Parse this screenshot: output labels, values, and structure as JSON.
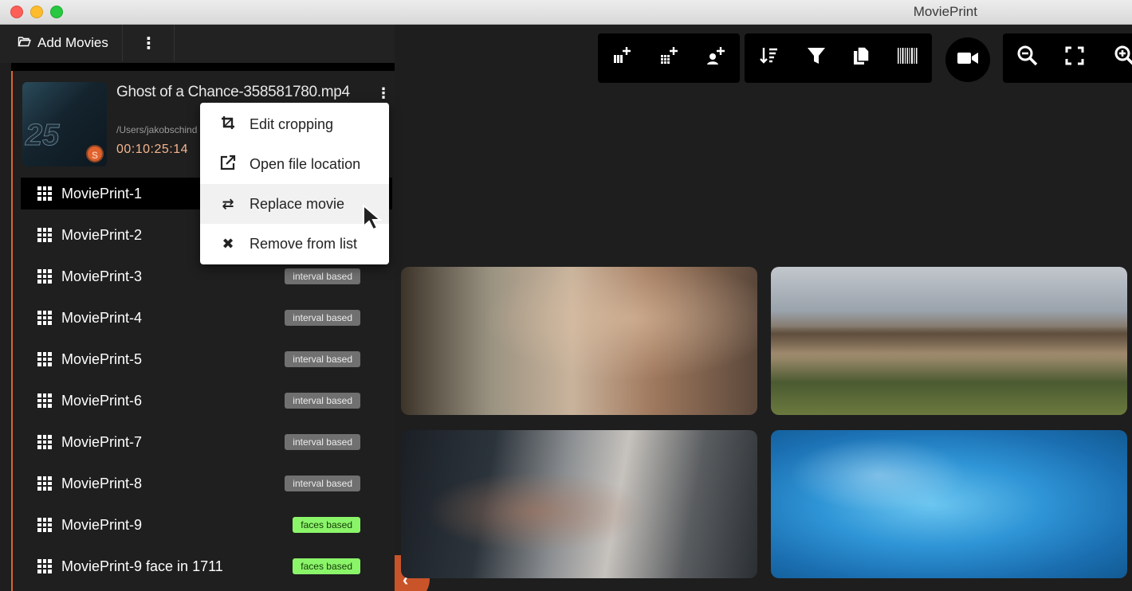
{
  "window": {
    "title": "MoviePrint"
  },
  "sidebar": {
    "add_movies_label": "Add Movies",
    "more_label": "⋮",
    "movie": {
      "name": "Ghost of a Chance-358581780.mp4",
      "path": "/Users/jakobschind",
      "duration": "00:10:25:14",
      "thumb_number": "25",
      "thumb_badge": "S"
    },
    "items": [
      {
        "label": "MoviePrint-1",
        "tag": ""
      },
      {
        "label": "MoviePrint-2",
        "tag": ""
      },
      {
        "label": "MoviePrint-3",
        "tag": "interval based"
      },
      {
        "label": "MoviePrint-4",
        "tag": "interval based"
      },
      {
        "label": "MoviePrint-5",
        "tag": "interval based"
      },
      {
        "label": "MoviePrint-6",
        "tag": "interval based"
      },
      {
        "label": "MoviePrint-7",
        "tag": "interval based"
      },
      {
        "label": "MoviePrint-8",
        "tag": "interval based"
      },
      {
        "label": "MoviePrint-9",
        "tag": "faces based"
      },
      {
        "label": "MoviePrint-9 face in 1711",
        "tag": "faces based"
      }
    ]
  },
  "context_menu": {
    "items": [
      {
        "label": "Edit cropping",
        "icon": "crop-icon"
      },
      {
        "label": "Open file location",
        "icon": "external-link-icon"
      },
      {
        "label": "Replace movie",
        "icon": "swap-icon"
      },
      {
        "label": "Remove from list",
        "icon": "close-icon"
      }
    ],
    "hovered": "Replace movie"
  },
  "toolbar": {
    "groups": [
      [
        "add-interval-icon",
        "add-shots-icon",
        "add-faces-icon"
      ],
      [
        "sort-icon",
        "filter-icon",
        "copy-icon",
        "barcode-icon"
      ],
      [
        "video-camera-icon"
      ],
      [
        "zoom-out-icon",
        "fullscreen-icon",
        "zoom-in-icon"
      ]
    ]
  },
  "colors": {
    "accent": "#e0622d",
    "interval_tag": "#707070",
    "faces_tag": "#8bf56a",
    "duration": "#f4b58f"
  }
}
